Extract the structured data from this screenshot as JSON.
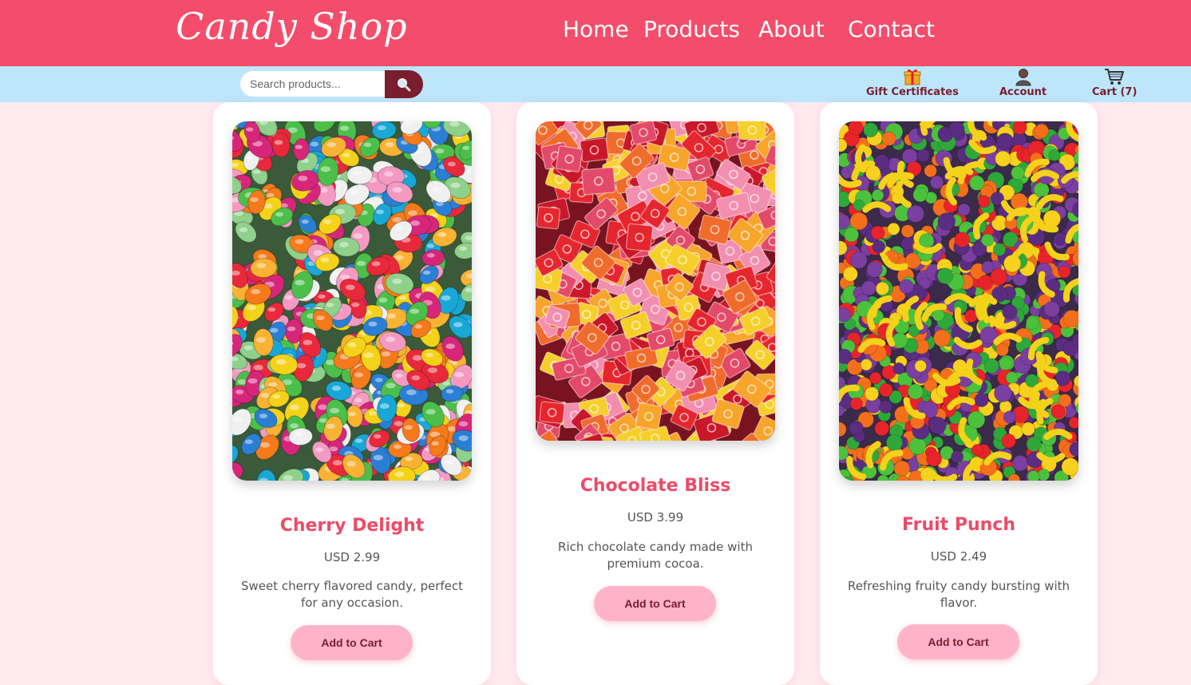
{
  "header": {
    "logo": "Candy Shop",
    "nav": [
      {
        "label": "Home"
      },
      {
        "label": "Products"
      },
      {
        "label": "About"
      },
      {
        "label": "Contact"
      }
    ]
  },
  "subbar": {
    "search": {
      "placeholder": "Search products...",
      "button_icon": "search-icon"
    },
    "gift": {
      "label": "Gift Certificates",
      "icon": "gift-icon"
    },
    "account": {
      "label": "Account",
      "icon": "person-icon"
    },
    "cart": {
      "label": "Cart (7)",
      "icon": "cart-icon"
    }
  },
  "products": [
    {
      "name": "Cherry Delight",
      "price": "USD 2.99",
      "description": "Sweet cherry flavored candy, perfect for any occasion.",
      "button": "Add to Cart",
      "image": "jelly-beans-photo"
    },
    {
      "name": "Chocolate Bliss",
      "price": "USD 3.99",
      "description": "Rich chocolate candy made with premium cocoa.",
      "button": "Add to Cart",
      "image": "wrapped-chews-photo"
    },
    {
      "name": "Fruit Punch",
      "price": "USD 2.49",
      "description": "Refreshing fruity candy bursting with flavor.",
      "button": "Add to Cart",
      "image": "fruit-candy-photo"
    }
  ],
  "colors": {
    "header": "#f44d6b",
    "subbar": "#bde6fb",
    "accent": "#7a1d2e",
    "button": "#ffb3c8",
    "title": "#ef4a68"
  }
}
